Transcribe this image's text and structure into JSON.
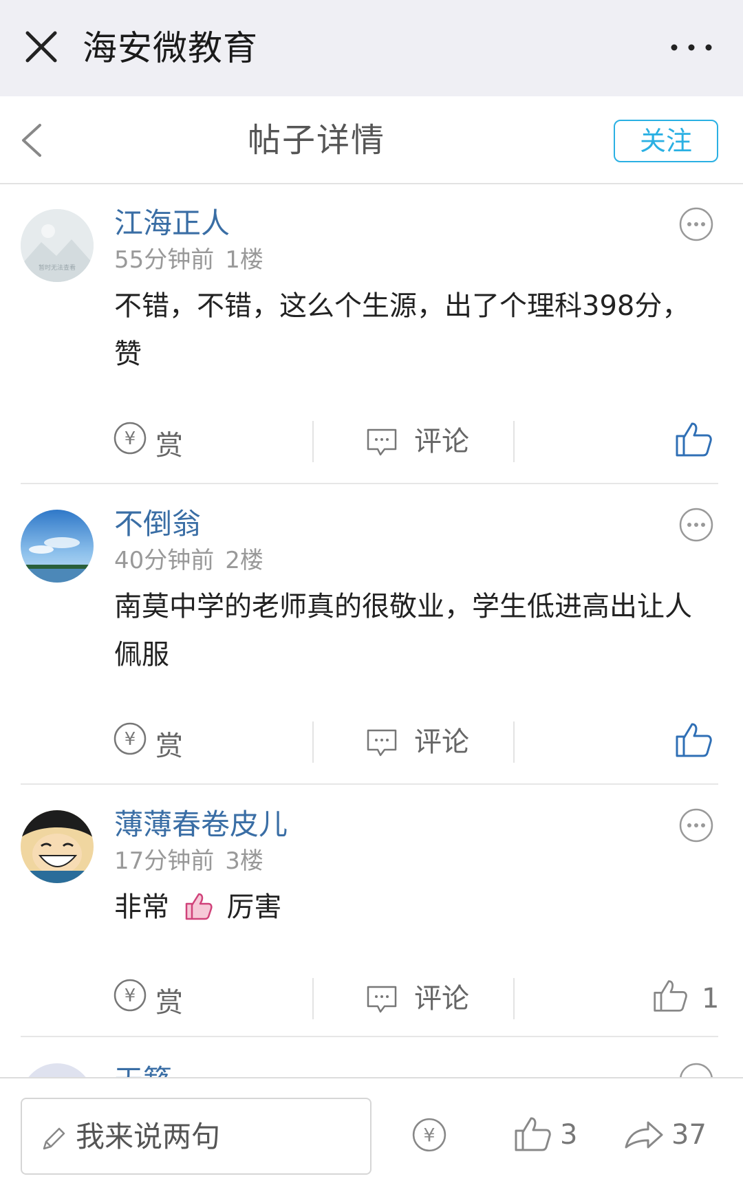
{
  "app": {
    "title": "海安微教育"
  },
  "nav": {
    "title": "帖子详情",
    "follow_label": "关注"
  },
  "posts": [
    {
      "username": "江海正人",
      "time": "55分钟前",
      "floor": "1楼",
      "lines": [
        "不错，不错，这么个生源，出了个理科398分，",
        "赞"
      ],
      "reward_label": "赏",
      "comment_label": "评论",
      "likes": ""
    },
    {
      "username": "不倒翁",
      "time": "40分钟前",
      "floor": "2楼",
      "lines": [
        "南莫中学的老师真的很敬业，学生低进高出让人",
        "佩服"
      ],
      "reward_label": "赏",
      "comment_label": "评论",
      "likes": ""
    },
    {
      "username": "薄薄春卷皮儿",
      "time": "17分钟前",
      "floor": "3楼",
      "text_before": "非常",
      "text_after": "厉害",
      "reward_label": "赏",
      "comment_label": "评论",
      "likes": "1"
    },
    {
      "username": "天籁"
    }
  ],
  "avatar1_text": "暂时无法查看",
  "bottom": {
    "placeholder": "我来说两句",
    "likes": "3",
    "shares": "37"
  },
  "colors": {
    "accent": "#2ab0e3",
    "username": "#3a6ea5",
    "like_icon": "#2f6fb5"
  }
}
